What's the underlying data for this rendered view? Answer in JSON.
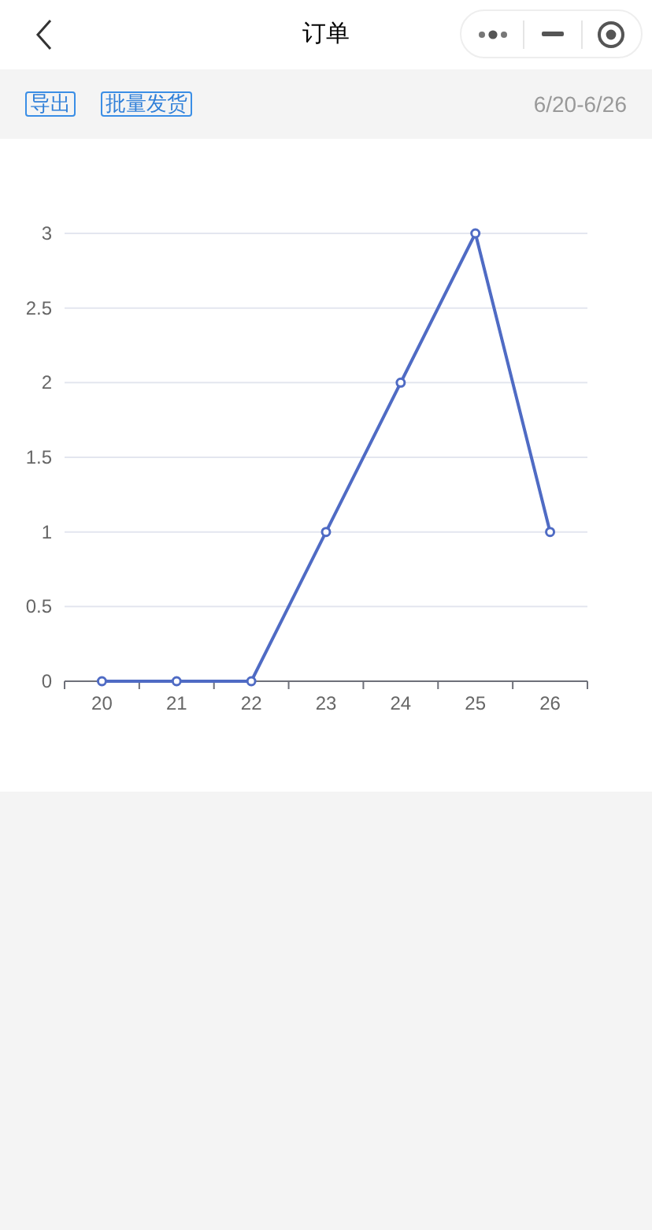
{
  "nav": {
    "title": "订单"
  },
  "toolbar": {
    "actions": [
      "导出",
      "批量发货"
    ],
    "date_range": "6/20-6/26"
  },
  "chart_data": {
    "type": "line",
    "categories": [
      "20",
      "21",
      "22",
      "23",
      "24",
      "25",
      "26"
    ],
    "grid": true,
    "series": [
      {
        "color": "#4f6bc4",
        "marker": true,
        "values": [
          0,
          0,
          0,
          1,
          2,
          3,
          1
        ]
      }
    ],
    "ylim": [
      0,
      3
    ],
    "yticks": [
      0,
      0.5,
      1,
      1.5,
      2,
      2.5,
      3
    ]
  }
}
